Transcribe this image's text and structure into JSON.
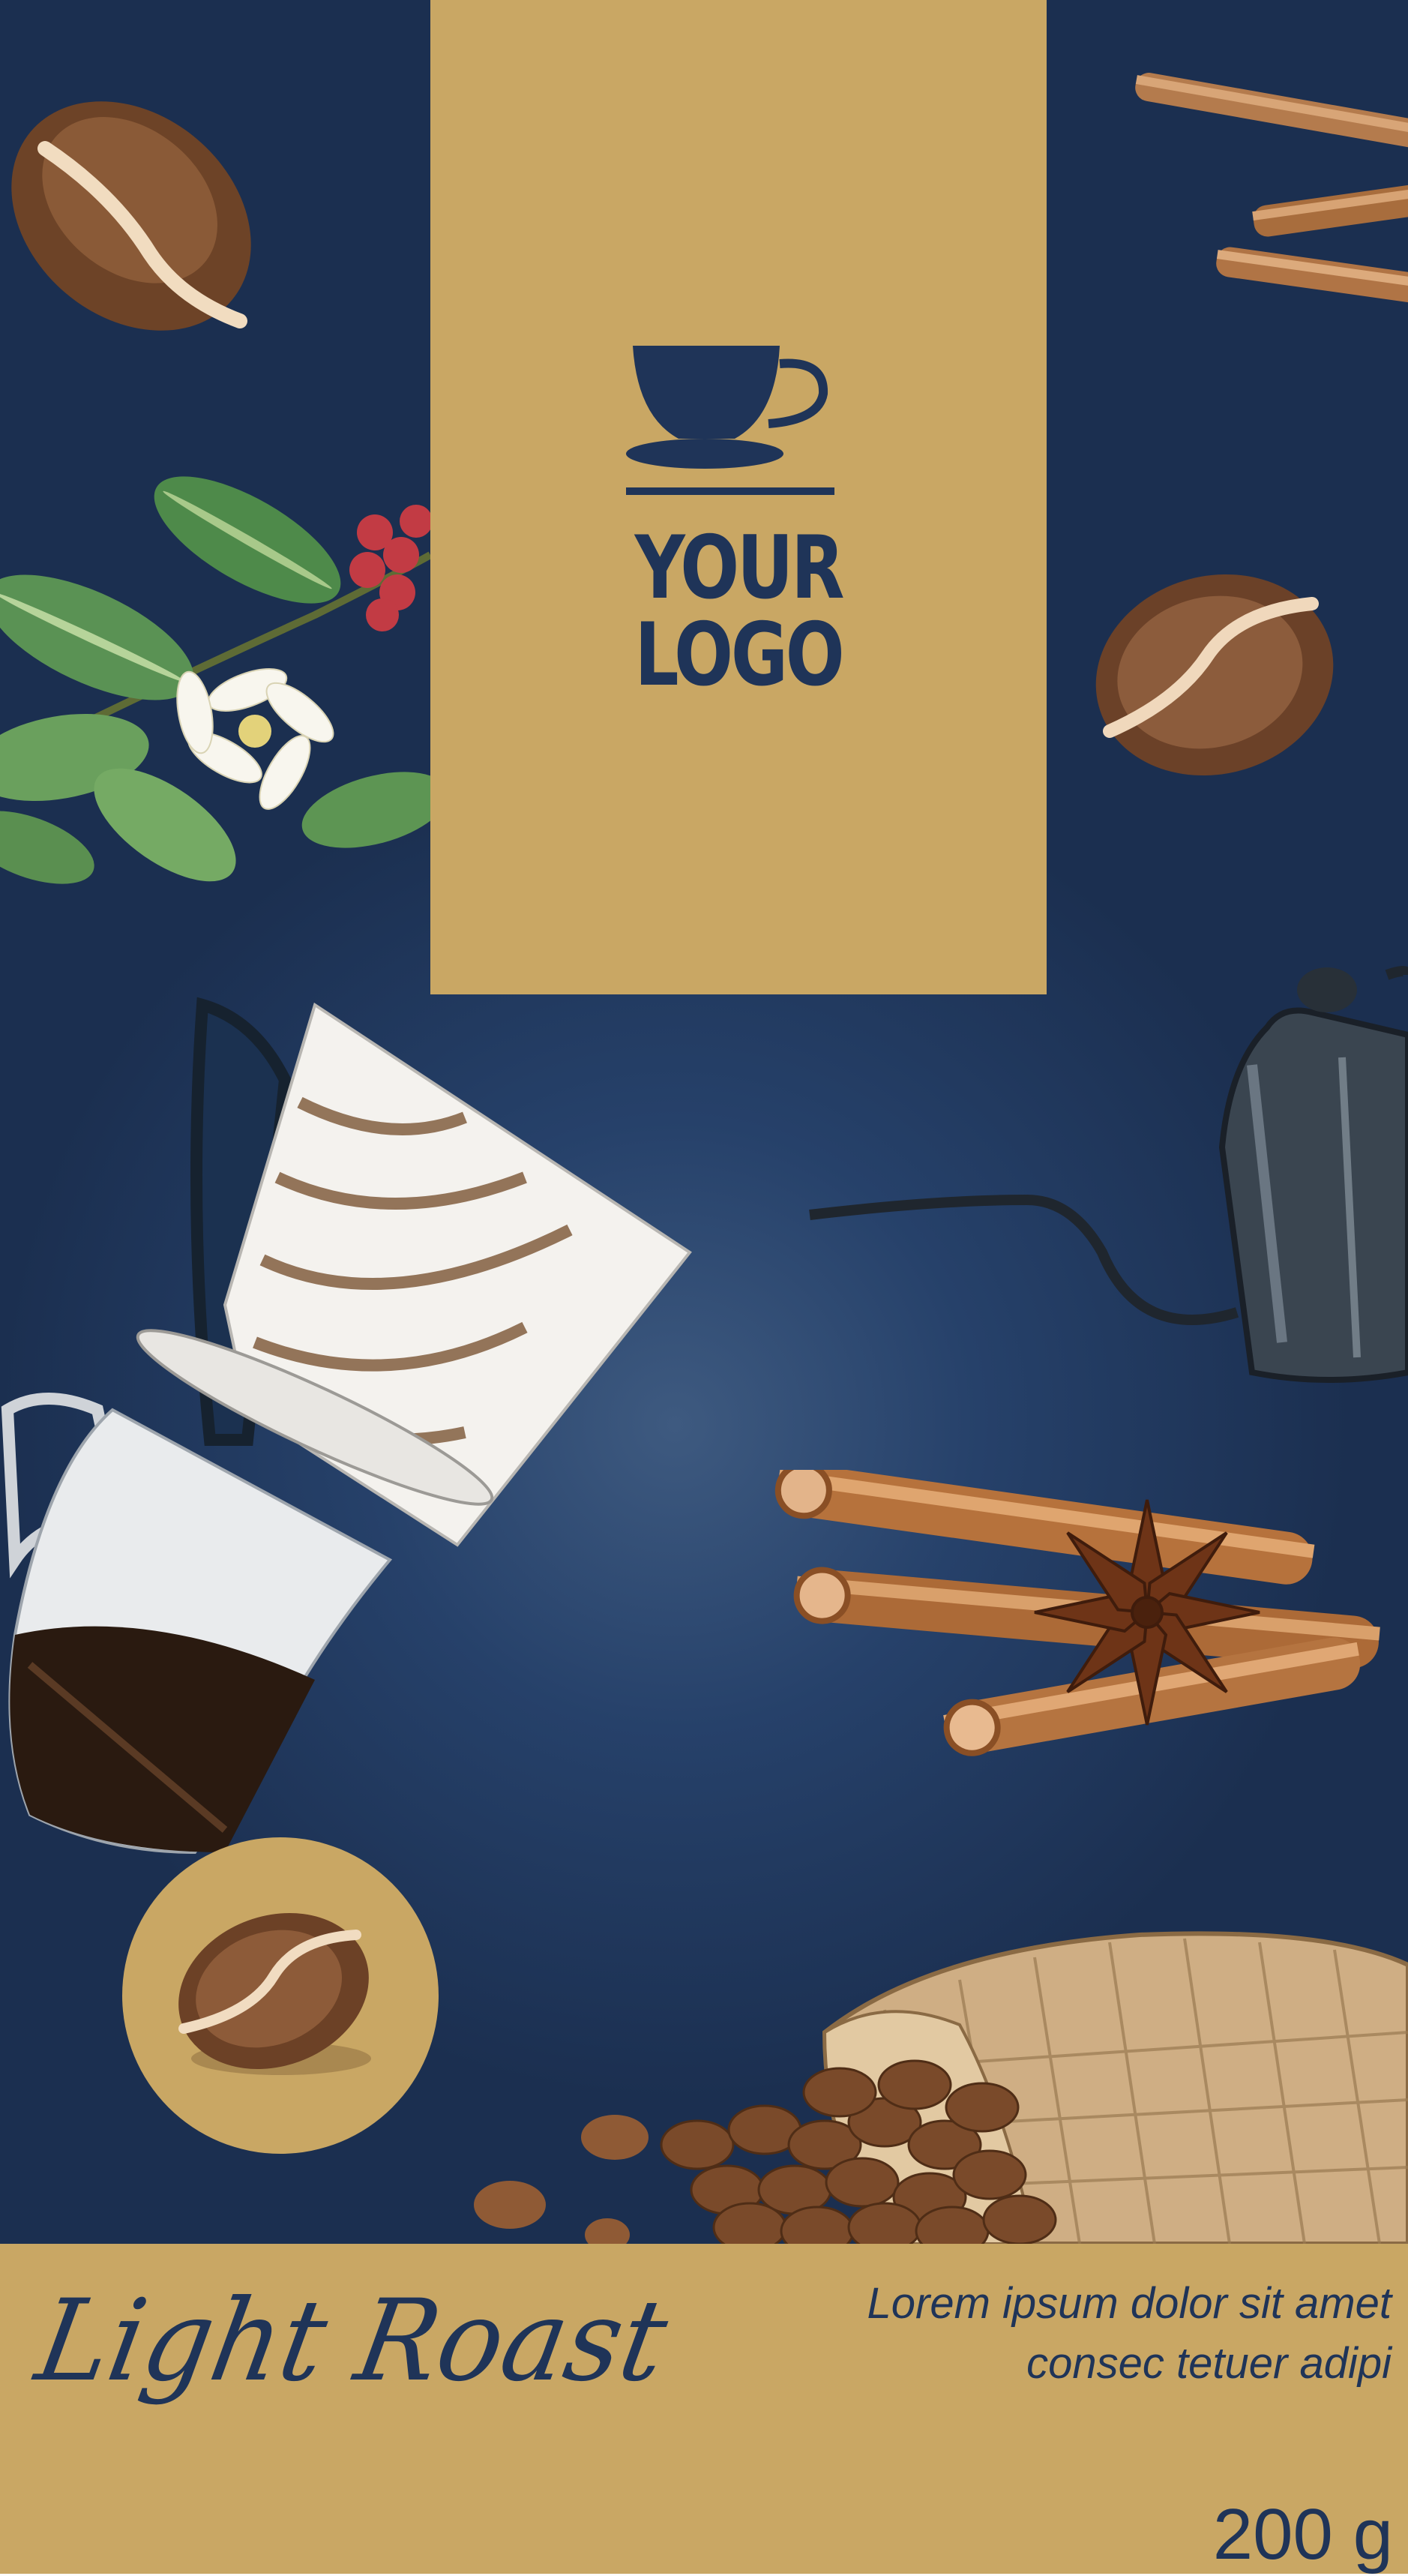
{
  "logo": {
    "line1": "YOUR",
    "line2": "LOGO",
    "icon": "cup-icon"
  },
  "footer": {
    "roast_label": "Light Roast",
    "description_line1": "Lorem ipsum dolor sit amet",
    "description_line2": "consec tetuer adipi",
    "weight": "200 g"
  },
  "colors": {
    "navy": "#1f3458",
    "gold": "#c9a764",
    "background": "#26416a"
  },
  "illustrations": [
    "coffee-bean-icon",
    "cinnamon-sticks-icon",
    "coffee-branch-icon",
    "pour-over-dripper-icon",
    "gooseneck-kettle-icon",
    "cinnamon-star-anise-icon",
    "burlap-sack-beans-icon"
  ]
}
